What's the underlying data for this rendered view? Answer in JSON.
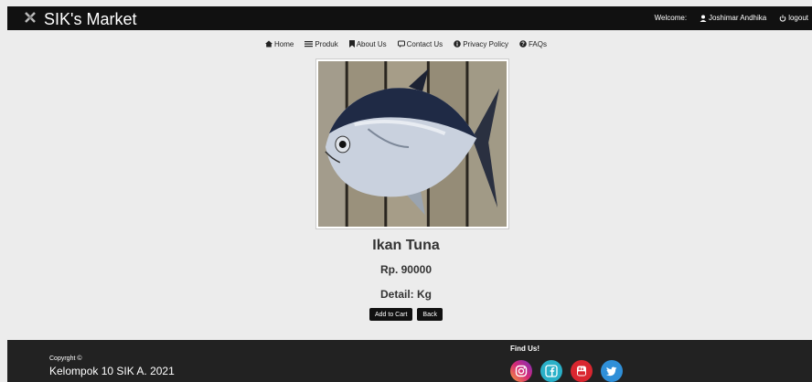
{
  "header": {
    "title": "SIK's Market",
    "welcome_label": "Welcome:",
    "user_name": "Joshimar Andhika",
    "logout_label": "logout"
  },
  "nav": {
    "items": [
      {
        "label": "Home",
        "icon": "home-icon"
      },
      {
        "label": "Produk",
        "icon": "list-icon"
      },
      {
        "label": "About Us",
        "icon": "bookmark-icon"
      },
      {
        "label": "Contact Us",
        "icon": "comment-icon"
      },
      {
        "label": "Privacy Policy",
        "icon": "info-icon"
      },
      {
        "label": "FAQs",
        "icon": "question-icon"
      }
    ]
  },
  "product": {
    "name": "Ikan Tuna",
    "price": "Rp. 90000",
    "detail": "Detail: Kg"
  },
  "actions": {
    "add_to_cart_label": "Add to Cart",
    "back_label": "Back"
  },
  "footer": {
    "copyright_label": "Copyrght ©",
    "copyright_text": "Kelompok 10 SIK A. 2021",
    "find_us": "Find Us!",
    "socials": [
      "instagram-icon",
      "facebook-icon",
      "youtube-icon",
      "twitter-icon"
    ]
  },
  "colors": {
    "topbar": "#111111",
    "footer": "#222222",
    "background": "#ececec",
    "button": "#111111"
  }
}
